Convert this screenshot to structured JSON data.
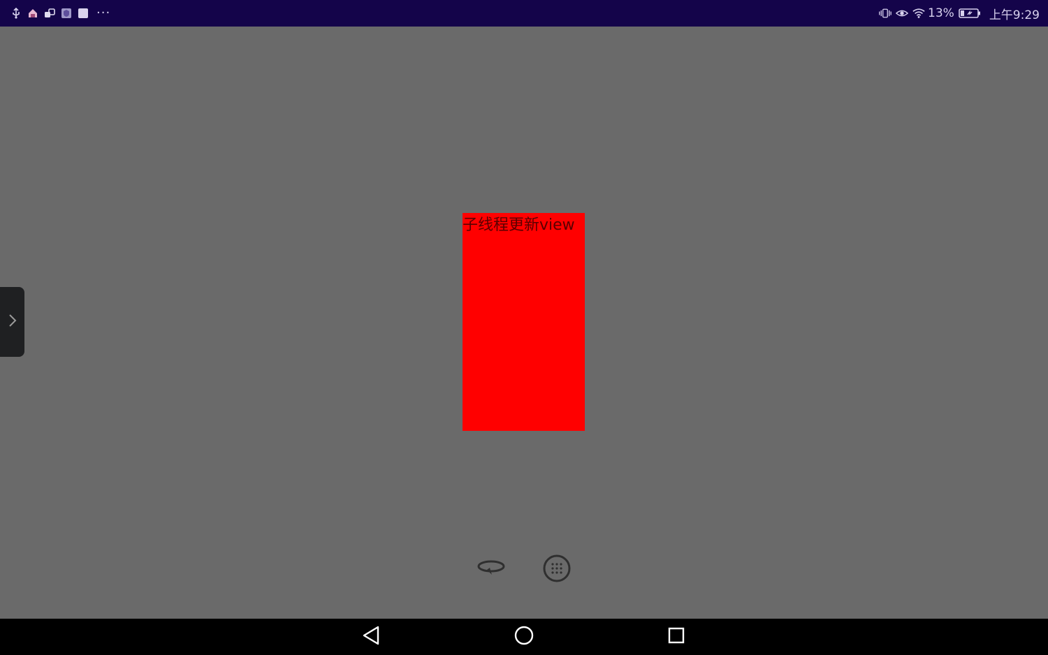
{
  "status_bar": {
    "left_icons": [
      "usb-icon",
      "home-app-icon",
      "transfer-app-icon",
      "shield-app-icon",
      "blank-app-icon"
    ],
    "overflow": "···",
    "right_icons": [
      "vibrate-icon",
      "eye-icon",
      "wifi-icon",
      "battery-icon"
    ],
    "battery_level": "13%",
    "time": "上午9:29",
    "background": "#14044a"
  },
  "main": {
    "background": "#6a6a6a",
    "red_view": {
      "label": "子线程更新view",
      "color": "#ff0000"
    },
    "side_handle_icon": "chevron-right-icon",
    "floating_tools": [
      "rotate-icon",
      "grid-menu-icon"
    ]
  },
  "nav_bar": {
    "buttons": [
      "back-icon",
      "home-icon",
      "recents-icon"
    ]
  }
}
